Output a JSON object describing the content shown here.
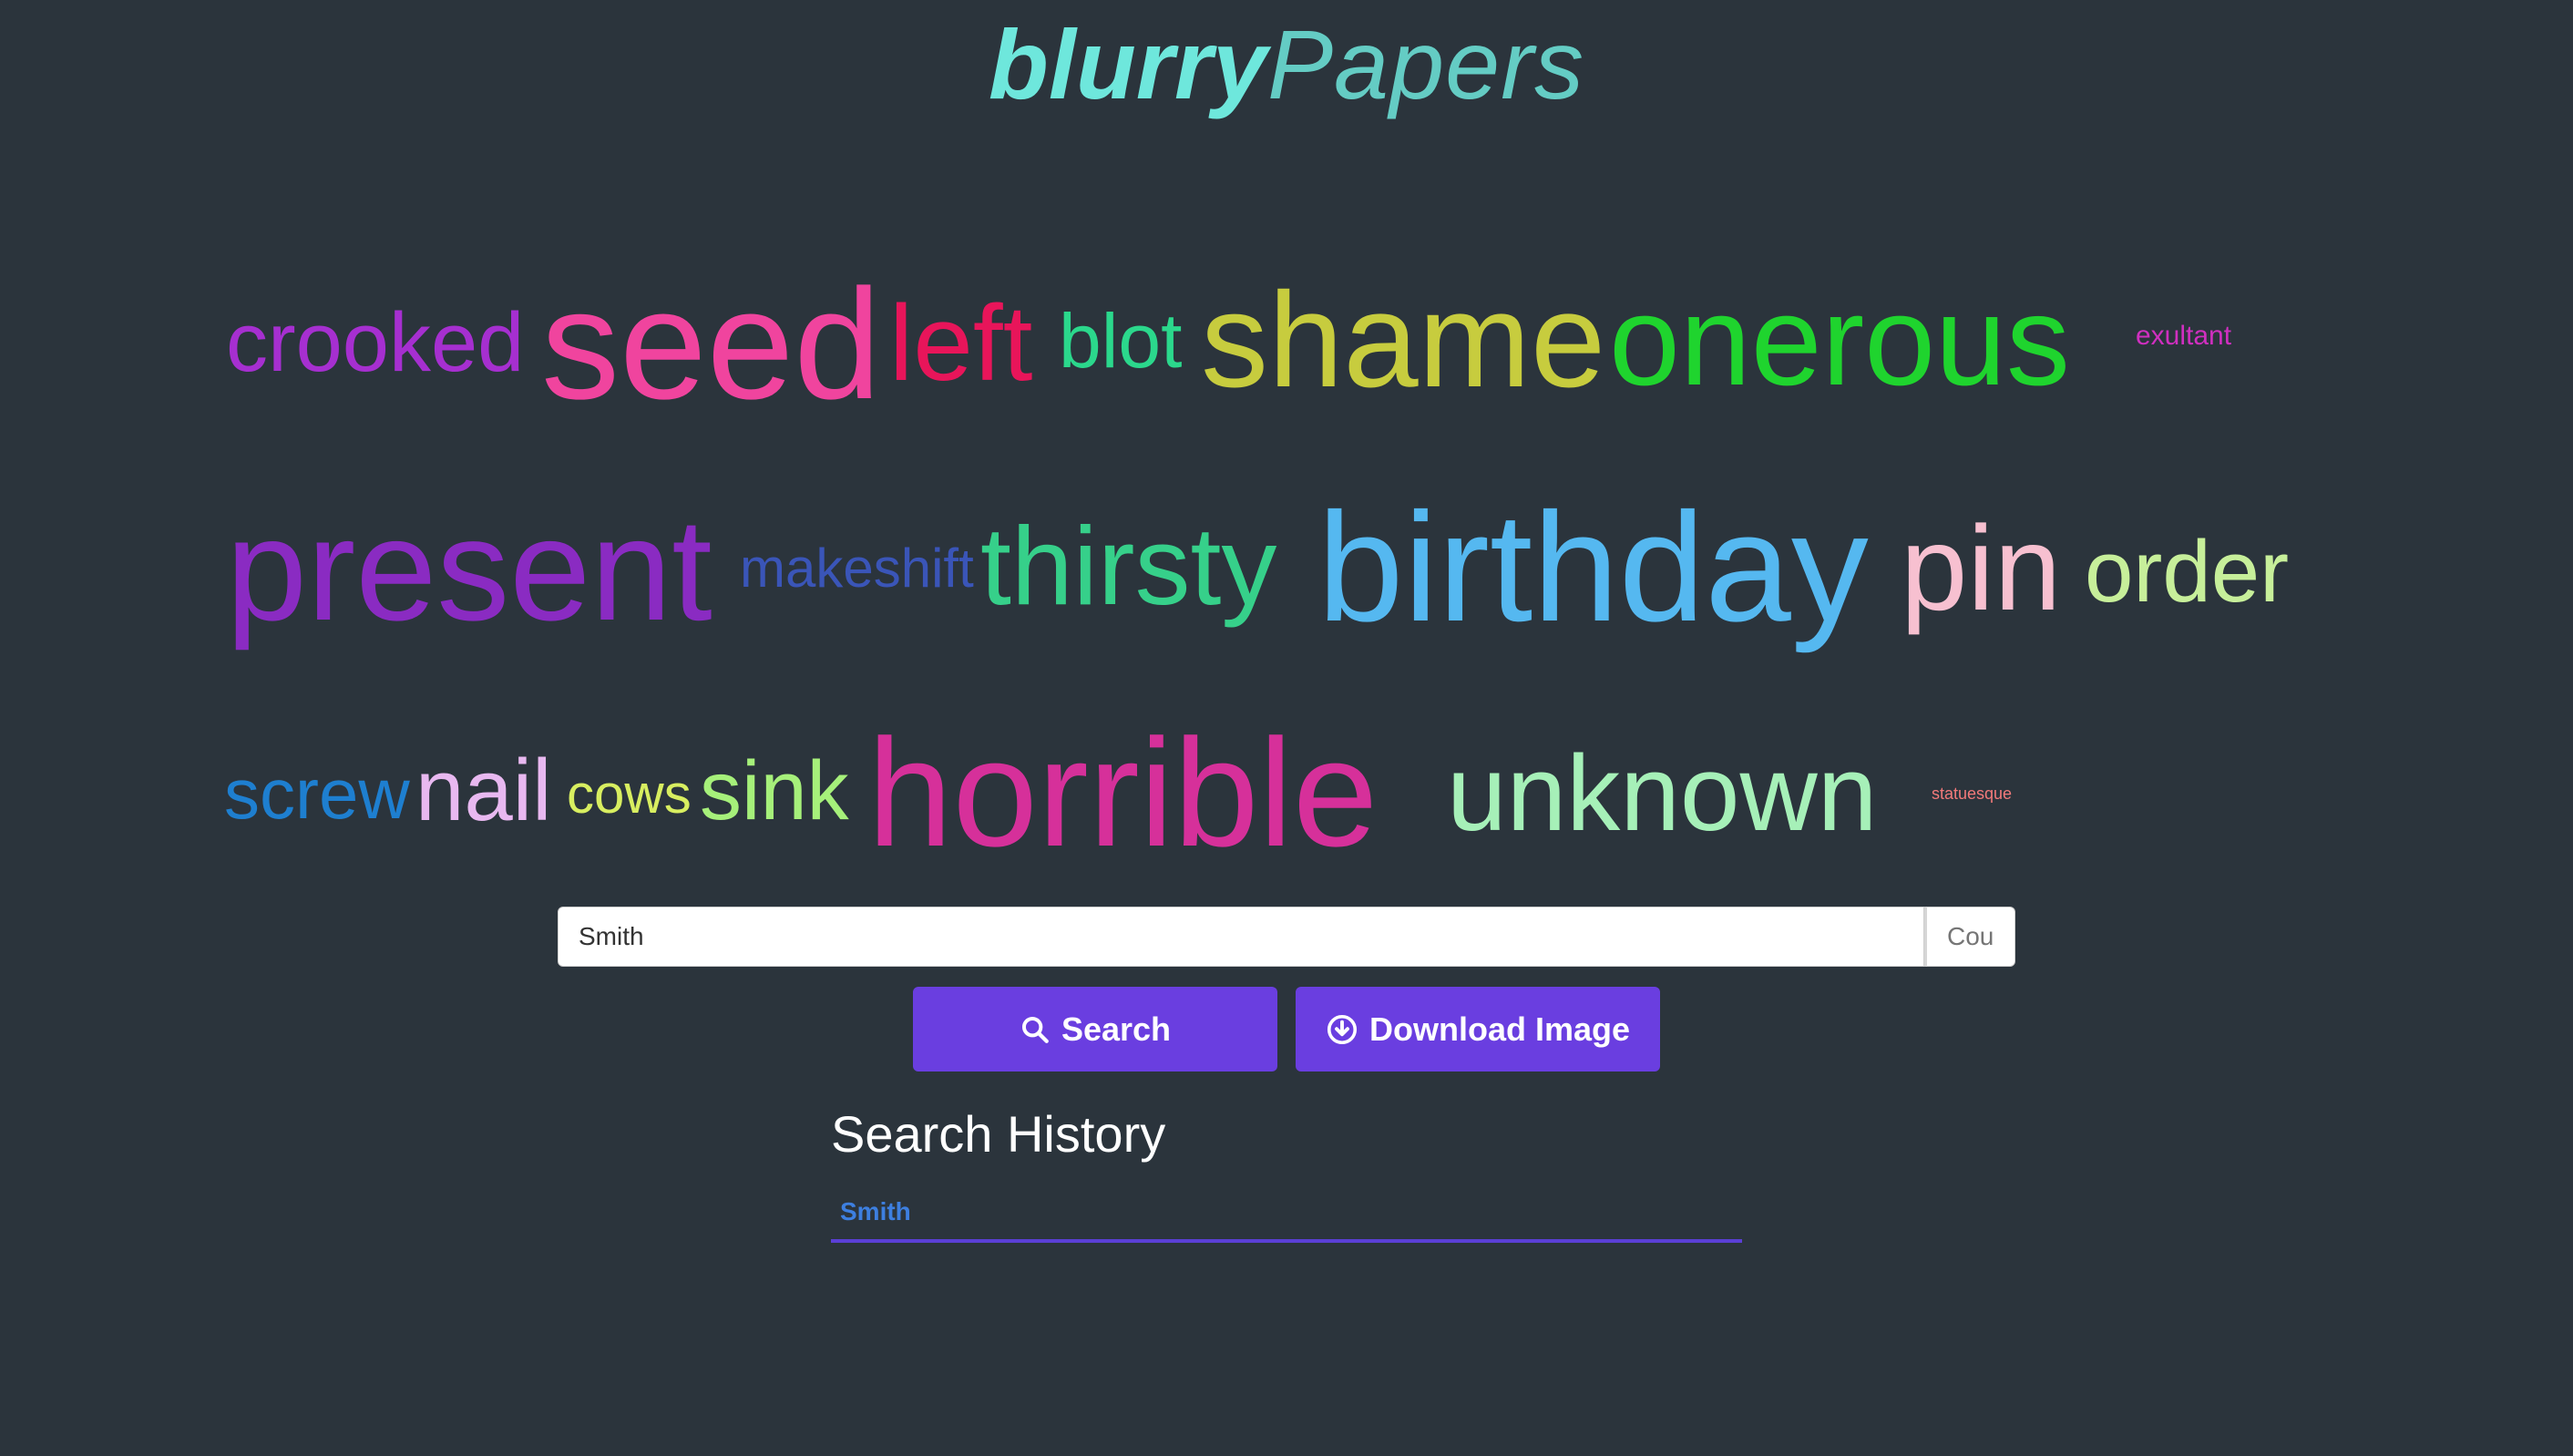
{
  "logo": {
    "bold": "blurry",
    "thin": "Papers"
  },
  "word_cloud": {
    "words": [
      {
        "text": "crooked",
        "color": "#a62fd0"
      },
      {
        "text": "seed",
        "color": "#f0449e"
      },
      {
        "text": "left",
        "color": "#e8155a"
      },
      {
        "text": "blot",
        "color": "#2bd88c"
      },
      {
        "text": "shame",
        "color": "#c7cc3e"
      },
      {
        "text": "onerous",
        "color": "#1fd42e"
      },
      {
        "text": "exultant",
        "color": "#d02fc0"
      },
      {
        "text": "present",
        "color": "#8a2bc2"
      },
      {
        "text": "makeshift",
        "color": "#3a55b8"
      },
      {
        "text": "thirsty",
        "color": "#36d08a"
      },
      {
        "text": "birthday",
        "color": "#55b8f0"
      },
      {
        "text": "pin",
        "color": "#f7c0d0"
      },
      {
        "text": "order",
        "color": "#c7ef9a"
      },
      {
        "text": "screw",
        "color": "#1e7fd0"
      },
      {
        "text": "nail",
        "color": "#e8b8f0"
      },
      {
        "text": "cows",
        "color": "#d8ee60"
      },
      {
        "text": "sink",
        "color": "#a6f07a"
      },
      {
        "text": "horrible",
        "color": "#d6309a"
      },
      {
        "text": "unknown",
        "color": "#a6f0b8"
      },
      {
        "text": "statuesque",
        "color": "#f27a7a"
      }
    ]
  },
  "search": {
    "query_value": "Smith",
    "count_placeholder": "Cou"
  },
  "buttons": {
    "search_label": "Search",
    "download_label": "Download Image"
  },
  "history": {
    "title": "Search History",
    "items": [
      "Smith"
    ]
  },
  "colors": {
    "background": "#2b343c",
    "accent": "#6a3ee0",
    "logo": "#6ee7dc"
  }
}
